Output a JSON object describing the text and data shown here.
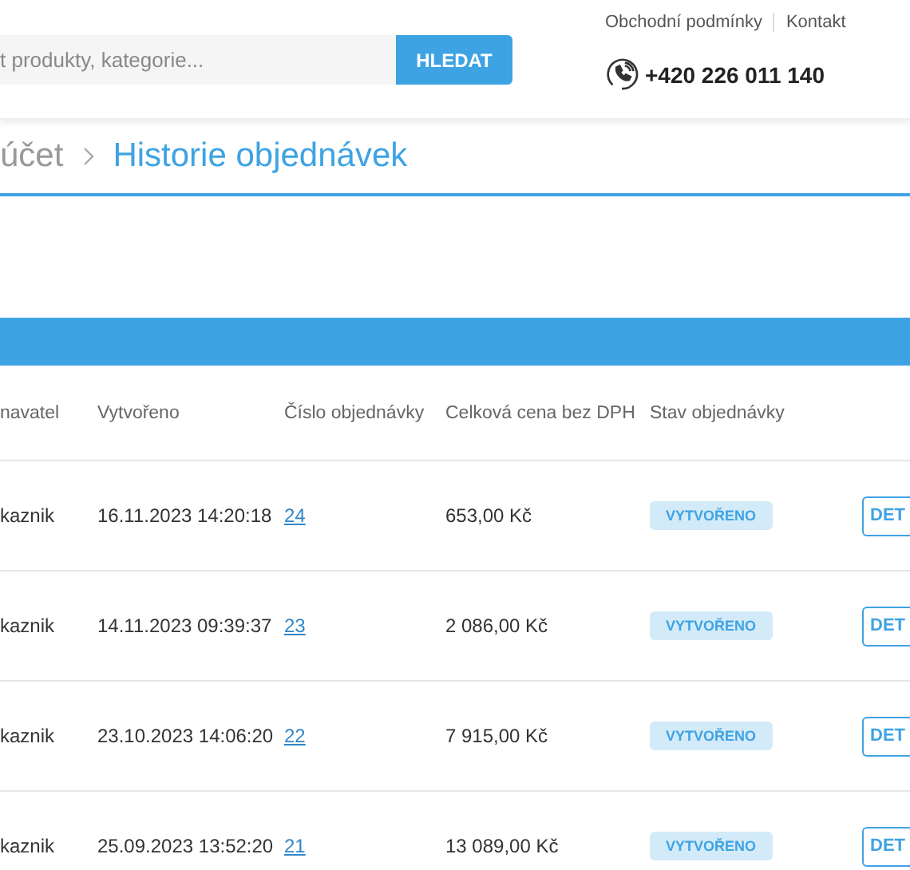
{
  "header": {
    "search": {
      "placeholder": "t produkty, kategorie..."
    },
    "search_button": "HLEDAT",
    "links": [
      "Obchodní podmínky",
      "Kontakt"
    ],
    "phone": "+420 226 011 140"
  },
  "breadcrumb": {
    "parent": "účet",
    "current": "Historie objednávek"
  },
  "table": {
    "columns": [
      "navatel",
      "Vytvořeno",
      "Číslo objednávky",
      "Celková cena bez DPH",
      "Stav objednávky"
    ],
    "rows": [
      {
        "customer": "kaznik",
        "created": "16.11.2023 14:20:18",
        "number": "24",
        "total": "653,00 Kč",
        "status": "VYTVOŘENO",
        "action": "DET"
      },
      {
        "customer": "kaznik",
        "created": "14.11.2023 09:39:37",
        "number": "23",
        "total": "2 086,00 Kč",
        "status": "VYTVOŘENO",
        "action": "DET"
      },
      {
        "customer": "kaznik",
        "created": "23.10.2023 14:06:20",
        "number": "22",
        "total": "7 915,00 Kč",
        "status": "VYTVOŘENO",
        "action": "DET"
      },
      {
        "customer": "kaznik",
        "created": "25.09.2023 13:52:20",
        "number": "21",
        "total": "13 089,00 Kč",
        "status": "VYTVOŘENO",
        "action": "DET"
      }
    ]
  }
}
